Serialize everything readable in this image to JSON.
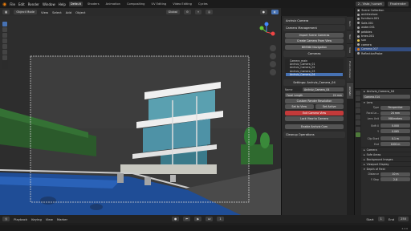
{
  "topbar": {
    "menus": [
      "File",
      "Edit",
      "Render",
      "Window",
      "Help"
    ],
    "workspaces": [
      "Default",
      "Shaders",
      "Animation",
      "Compositing",
      "UV Editing",
      "Video Editing",
      "Cycles"
    ],
    "active_workspace": "Default",
    "scene": "2 - Vista / sunset",
    "view_layer": "Finalrender"
  },
  "viewport_header": {
    "mode": "Object Mode",
    "menus": [
      "View",
      "Select",
      "Add",
      "Object"
    ],
    "orientation": "Global"
  },
  "npanel": {
    "title": "Archviz Camera",
    "camera_management": {
      "header": "Camera Management",
      "buttons": [
        "Import Scene Cameras",
        "Create Camera From View",
        "BIM360 Navigation"
      ]
    },
    "cameras": {
      "header": "Cameras",
      "items": [
        "Camera_main",
        "Archviz_Camera_01",
        "Archviz_Camera_02",
        "Archviz_Camera_03",
        "Archviz_Camera_04"
      ],
      "selected_index": 4
    },
    "settings": {
      "header": "Settings: Archviz_Camera_04",
      "name_label": "Name",
      "name_value": "Archviz_Camera_04",
      "focal_label": "Focal Length",
      "focal_value": "24 mm",
      "custom_res_label": "Custom Render Resolution",
      "set_to_view": "Set to View",
      "set_active": "Set Active",
      "exit_camera_view": "Exit Camera View",
      "lock_view": "Lock View to Camera",
      "enable_archviz_cam": "Enable Archviz Cam",
      "cleanup": "Cleanup Operations"
    }
  },
  "sidetabs": [
    "Item",
    "Tool",
    "View",
    "Photo Modeler",
    "Archviz"
  ],
  "outliner": {
    "header": "Scene Collection",
    "items": [
      "architecture",
      "furniture.001",
      "Sofa.001",
      "water.001",
      "pebbles",
      "trees.001",
      "sun",
      "camera",
      "Camera.007",
      "ReflectionProbe"
    ],
    "selected_index": 8
  },
  "properties": {
    "object_name": "Archviz_Camera_04",
    "data_name": "Camera.014",
    "lens_header": "Lens",
    "type_label": "Type",
    "type_value": "Perspective",
    "focal_label": "Focal Le...",
    "focal_value": "24 mm",
    "lens_unit_label": "Lens Unit",
    "lens_unit_value": "Millimeters",
    "shift_x_label": "Shift X",
    "shift_x_value": "0.000",
    "shift_y_label": "Y",
    "shift_y_value": "0.065",
    "clip_start_label": "Clip Start",
    "clip_start_value": "0.1 m",
    "clip_end_label": "End",
    "clip_end_value": "1000 m",
    "subpanels": [
      "Camera",
      "Safe Areas",
      "Background Images",
      "Viewport Display",
      "Depth of Field"
    ],
    "dof_distance_label": "Distance",
    "dof_distance_value": "10 m",
    "fstop_label": "F-Stop",
    "fstop_value": "2.8"
  },
  "timeline": {
    "menus": [
      "Playback",
      "Keying",
      "View",
      "Marker"
    ],
    "current_frame": "1",
    "start_label": "Start",
    "start_value": "1",
    "end_label": "End",
    "end_value": "250"
  },
  "status": {
    "version": "4.2.0"
  },
  "colors": {
    "accent": "#4772b3",
    "danger": "#c33a3a",
    "sky": "#333333",
    "water": "#1f4d96"
  }
}
